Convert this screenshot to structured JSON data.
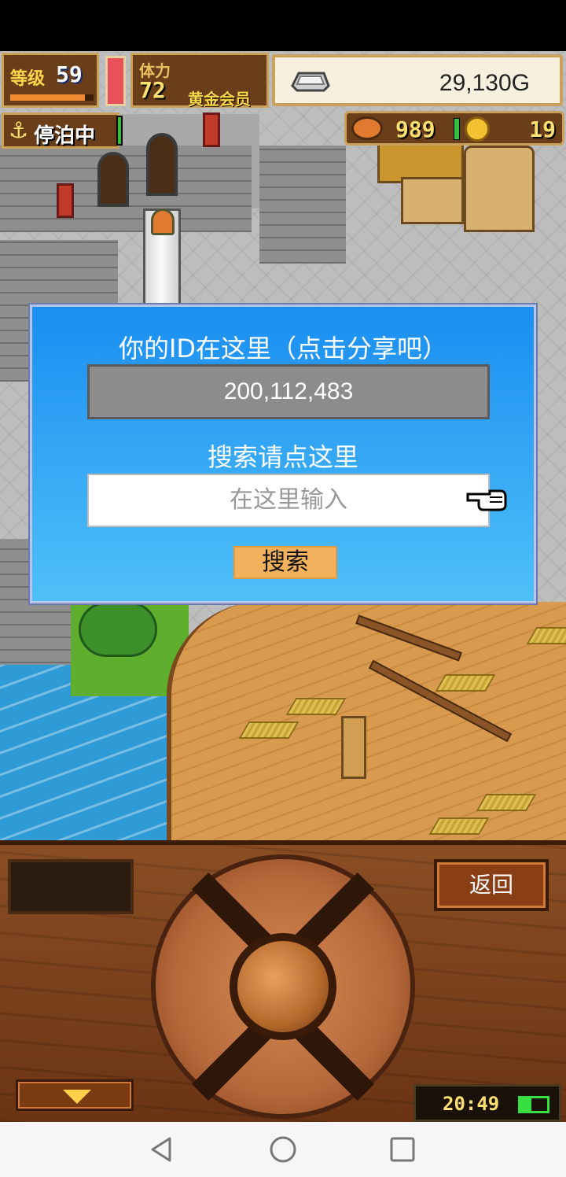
{
  "hud": {
    "level_label": "等级",
    "level_value": "59",
    "level_progress": 0.9,
    "stamina_label": "体力",
    "stamina_value": "72",
    "stamina_fill": 1.0,
    "vip_label": "黄金会员",
    "gold_value": "29,130G",
    "dock_status": "停泊中",
    "food_value": "989",
    "coin_value": "19"
  },
  "dialog": {
    "title": "你的ID在这里（点击分享吧）",
    "id_value": "200,112,483",
    "search_hint": "搜索请点这里",
    "search_placeholder": "在这里输入",
    "search_button_label": "搜索"
  },
  "panel": {
    "back_label": "返回",
    "clock": "20:49",
    "battery_level": 0.4
  },
  "colors": {
    "dialog_top": "#1a8ef2",
    "dialog_bottom": "#4fc0f8",
    "search_button": "#f2b15c",
    "panel_wood": "#8a4e24"
  },
  "icons": [
    "ingot-icon",
    "anchor-icon",
    "food-icon",
    "coin-icon",
    "pointer-icon",
    "chevron-down-icon",
    "battery-icon",
    "back-nav-icon",
    "home-nav-icon",
    "recents-nav-icon"
  ]
}
